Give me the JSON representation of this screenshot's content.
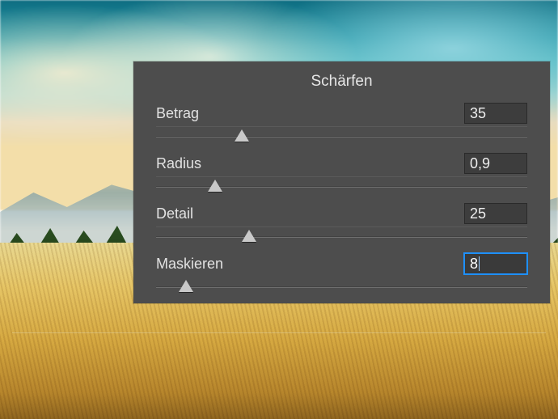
{
  "panel": {
    "title": "Schärfen",
    "rows": [
      {
        "key": "amount",
        "label": "Betrag",
        "value": "35",
        "thumb_pct": 23,
        "focused": false
      },
      {
        "key": "radius",
        "label": "Radius",
        "value": "0,9",
        "thumb_pct": 16,
        "focused": false
      },
      {
        "key": "detail",
        "label": "Detail",
        "value": "25",
        "thumb_pct": 25,
        "focused": false
      },
      {
        "key": "masking",
        "label": "Maskieren",
        "value": "8",
        "thumb_pct": 8,
        "focused": true
      }
    ]
  }
}
